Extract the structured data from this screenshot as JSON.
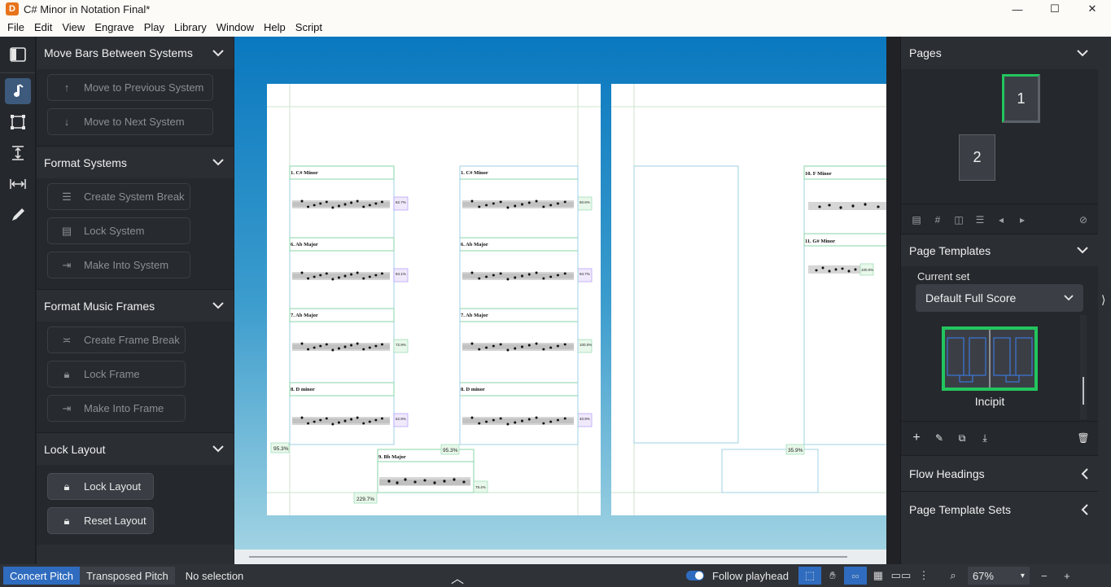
{
  "window": {
    "title": "C# Minor in Notation Final*",
    "icon_label": "D"
  },
  "menu": [
    "File",
    "Edit",
    "View",
    "Engrave",
    "Play",
    "Library",
    "Window",
    "Help",
    "Script"
  ],
  "left_panel": {
    "move_bars": {
      "title": "Move Bars Between Systems",
      "buttons": [
        "Move to Previous System",
        "Move to Next System"
      ]
    },
    "format_systems": {
      "title": "Format Systems",
      "buttons": [
        "Create System Break",
        "Lock System",
        "Make Into System"
      ]
    },
    "format_frames": {
      "title": "Format Music Frames",
      "buttons": [
        "Create Frame Break",
        "Lock Frame",
        "Make Into Frame"
      ]
    },
    "lock_layout": {
      "title": "Lock Layout",
      "buttons": [
        "Lock Layout",
        "Reset Layout"
      ]
    }
  },
  "score": {
    "page1": {
      "left_titles": [
        "1. C# Minor",
        "6. Ab Major",
        "7. Ab Major",
        "8. D minor"
      ],
      "right_titles": [
        "1. C# Minor",
        "6. Ab Major",
        "7. Ab Major",
        "8. D minor"
      ],
      "bottom_title": "9. Bb Major",
      "left_pcts": [
        "62.7%",
        "94.1%",
        "72.9%",
        "52.9%"
      ],
      "right_pcts": [
        "60.6%",
        "94.7%",
        "100.0%",
        "40.9%"
      ],
      "frame_pcts": [
        "95.3%",
        "95.3%",
        "229.7%",
        "79.4%"
      ]
    },
    "page2": {
      "titles": [
        "10. F  Minor",
        "11. G# Minor"
      ],
      "pcts": [
        "100.0%",
        "35.9%"
      ]
    }
  },
  "right_panel": {
    "pages": {
      "title": "Pages",
      "thumbs": [
        "1",
        "2"
      ]
    },
    "page_templates": {
      "title": "Page Templates",
      "current_set_label": "Current set",
      "current_set_value": "Default Full Score",
      "template_name": "Incipit"
    },
    "flow_headings": {
      "title": "Flow Headings"
    },
    "template_sets": {
      "title": "Page Template Sets"
    }
  },
  "status": {
    "concert_pitch": "Concert Pitch",
    "transposed_pitch": "Transposed Pitch",
    "selection": "No selection",
    "follow_playhead": "Follow playhead",
    "zoom": "67%"
  },
  "colors": {
    "accent": "#2f6cbf",
    "frame_green": "#22c55e",
    "panel": "#2b2e33"
  }
}
